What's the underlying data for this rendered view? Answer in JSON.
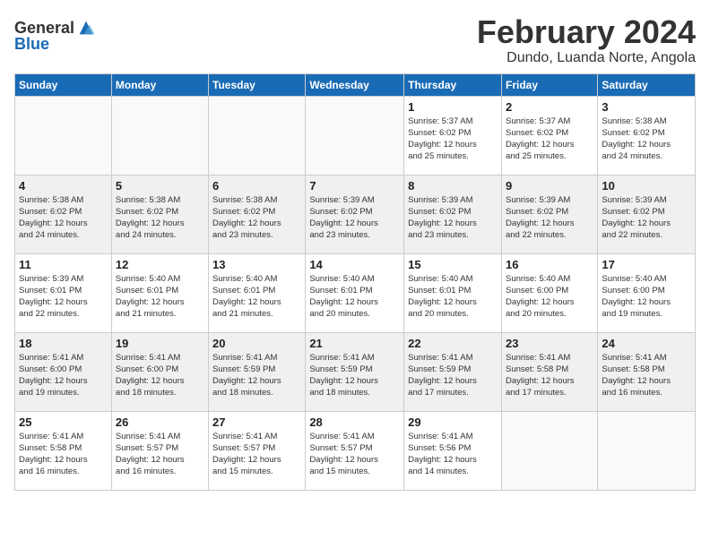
{
  "logo": {
    "text_general": "General",
    "text_blue": "Blue"
  },
  "title": "February 2024",
  "location": "Dundo, Luanda Norte, Angola",
  "weekdays": [
    "Sunday",
    "Monday",
    "Tuesday",
    "Wednesday",
    "Thursday",
    "Friday",
    "Saturday"
  ],
  "weeks": [
    [
      {
        "day": "",
        "info": ""
      },
      {
        "day": "",
        "info": ""
      },
      {
        "day": "",
        "info": ""
      },
      {
        "day": "",
        "info": ""
      },
      {
        "day": "1",
        "info": "Sunrise: 5:37 AM\nSunset: 6:02 PM\nDaylight: 12 hours\nand 25 minutes."
      },
      {
        "day": "2",
        "info": "Sunrise: 5:37 AM\nSunset: 6:02 PM\nDaylight: 12 hours\nand 25 minutes."
      },
      {
        "day": "3",
        "info": "Sunrise: 5:38 AM\nSunset: 6:02 PM\nDaylight: 12 hours\nand 24 minutes."
      }
    ],
    [
      {
        "day": "4",
        "info": "Sunrise: 5:38 AM\nSunset: 6:02 PM\nDaylight: 12 hours\nand 24 minutes."
      },
      {
        "day": "5",
        "info": "Sunrise: 5:38 AM\nSunset: 6:02 PM\nDaylight: 12 hours\nand 24 minutes."
      },
      {
        "day": "6",
        "info": "Sunrise: 5:38 AM\nSunset: 6:02 PM\nDaylight: 12 hours\nand 23 minutes."
      },
      {
        "day": "7",
        "info": "Sunrise: 5:39 AM\nSunset: 6:02 PM\nDaylight: 12 hours\nand 23 minutes."
      },
      {
        "day": "8",
        "info": "Sunrise: 5:39 AM\nSunset: 6:02 PM\nDaylight: 12 hours\nand 23 minutes."
      },
      {
        "day": "9",
        "info": "Sunrise: 5:39 AM\nSunset: 6:02 PM\nDaylight: 12 hours\nand 22 minutes."
      },
      {
        "day": "10",
        "info": "Sunrise: 5:39 AM\nSunset: 6:02 PM\nDaylight: 12 hours\nand 22 minutes."
      }
    ],
    [
      {
        "day": "11",
        "info": "Sunrise: 5:39 AM\nSunset: 6:01 PM\nDaylight: 12 hours\nand 22 minutes."
      },
      {
        "day": "12",
        "info": "Sunrise: 5:40 AM\nSunset: 6:01 PM\nDaylight: 12 hours\nand 21 minutes."
      },
      {
        "day": "13",
        "info": "Sunrise: 5:40 AM\nSunset: 6:01 PM\nDaylight: 12 hours\nand 21 minutes."
      },
      {
        "day": "14",
        "info": "Sunrise: 5:40 AM\nSunset: 6:01 PM\nDaylight: 12 hours\nand 20 minutes."
      },
      {
        "day": "15",
        "info": "Sunrise: 5:40 AM\nSunset: 6:01 PM\nDaylight: 12 hours\nand 20 minutes."
      },
      {
        "day": "16",
        "info": "Sunrise: 5:40 AM\nSunset: 6:00 PM\nDaylight: 12 hours\nand 20 minutes."
      },
      {
        "day": "17",
        "info": "Sunrise: 5:40 AM\nSunset: 6:00 PM\nDaylight: 12 hours\nand 19 minutes."
      }
    ],
    [
      {
        "day": "18",
        "info": "Sunrise: 5:41 AM\nSunset: 6:00 PM\nDaylight: 12 hours\nand 19 minutes."
      },
      {
        "day": "19",
        "info": "Sunrise: 5:41 AM\nSunset: 6:00 PM\nDaylight: 12 hours\nand 18 minutes."
      },
      {
        "day": "20",
        "info": "Sunrise: 5:41 AM\nSunset: 5:59 PM\nDaylight: 12 hours\nand 18 minutes."
      },
      {
        "day": "21",
        "info": "Sunrise: 5:41 AM\nSunset: 5:59 PM\nDaylight: 12 hours\nand 18 minutes."
      },
      {
        "day": "22",
        "info": "Sunrise: 5:41 AM\nSunset: 5:59 PM\nDaylight: 12 hours\nand 17 minutes."
      },
      {
        "day": "23",
        "info": "Sunrise: 5:41 AM\nSunset: 5:58 PM\nDaylight: 12 hours\nand 17 minutes."
      },
      {
        "day": "24",
        "info": "Sunrise: 5:41 AM\nSunset: 5:58 PM\nDaylight: 12 hours\nand 16 minutes."
      }
    ],
    [
      {
        "day": "25",
        "info": "Sunrise: 5:41 AM\nSunset: 5:58 PM\nDaylight: 12 hours\nand 16 minutes."
      },
      {
        "day": "26",
        "info": "Sunrise: 5:41 AM\nSunset: 5:57 PM\nDaylight: 12 hours\nand 16 minutes."
      },
      {
        "day": "27",
        "info": "Sunrise: 5:41 AM\nSunset: 5:57 PM\nDaylight: 12 hours\nand 15 minutes."
      },
      {
        "day": "28",
        "info": "Sunrise: 5:41 AM\nSunset: 5:57 PM\nDaylight: 12 hours\nand 15 minutes."
      },
      {
        "day": "29",
        "info": "Sunrise: 5:41 AM\nSunset: 5:56 PM\nDaylight: 12 hours\nand 14 minutes."
      },
      {
        "day": "",
        "info": ""
      },
      {
        "day": "",
        "info": ""
      }
    ]
  ]
}
